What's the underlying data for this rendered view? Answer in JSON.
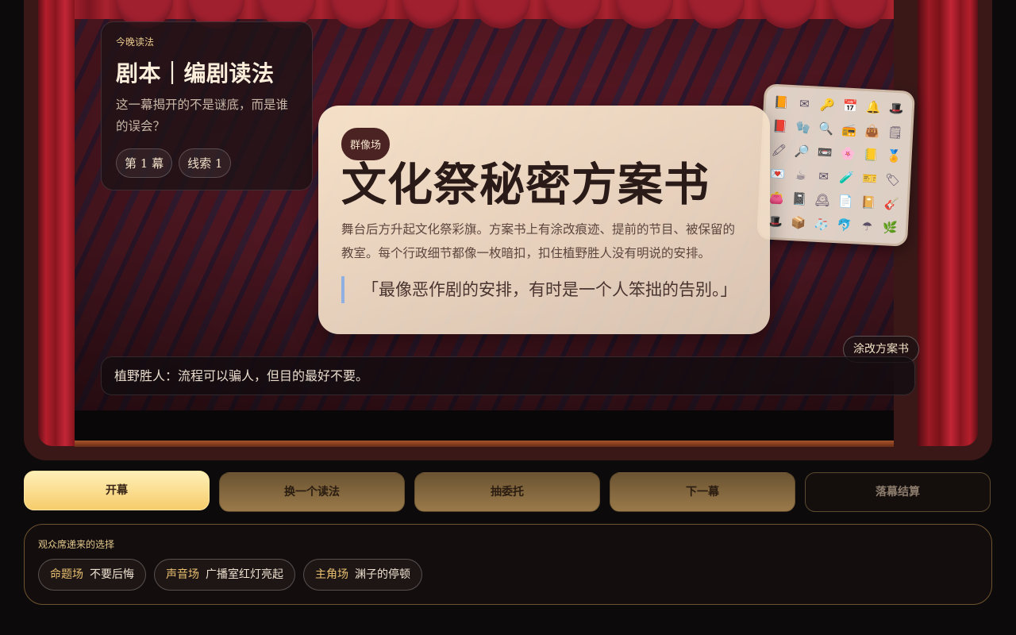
{
  "reading": {
    "kicker": "今晚读法",
    "title": "剧本｜编剧读法",
    "desc": "这一幕揭开的不是谜底，而是谁的误会？",
    "chips": [
      "第 1 幕",
      "线索 1"
    ]
  },
  "scene": {
    "badge": "群像场",
    "title": "文化祭秘密方案书",
    "desc": "舞台后方升起文化祭彩旗。方案书上有涂改痕迹、提前的节目、被保留的教室。每个行政细节都像一枚暗扣，扣住植野胜人没有明说的安排。",
    "quote": "「最像恶作剧的安排，有时是一个人笨拙的告别。」"
  },
  "item_grid_icons": [
    "📙",
    "✉",
    "🔑",
    "📅",
    "🔔",
    "🎩",
    "📕",
    "🧤",
    "🔍",
    "📻",
    "👜",
    "🗒",
    "🖍",
    "🔎",
    "📼",
    "🌸",
    "📒",
    "🏅",
    "💌",
    "☕",
    "✉",
    "🧪",
    "🎫",
    "🏷",
    "👛",
    "📓",
    "🕰",
    "📄",
    "📔",
    "🎸",
    "🎩",
    "📦",
    "🧦",
    "🐬",
    "☂",
    "🌿"
  ],
  "alter_button": "涂改方案书",
  "dialogue": "植野胜人：流程可以骗人，但目的最好不要。",
  "actions": [
    "开幕",
    "换一个读法",
    "抽委托",
    "下一幕",
    "落幕结算"
  ],
  "audience": {
    "kicker": "观众席递来的选择",
    "choices": [
      {
        "tag": "命题场",
        "text": "不要后悔"
      },
      {
        "tag": "声音场",
        "text": "广播室红灯亮起"
      },
      {
        "tag": "主角场",
        "text": "渊子的停顿"
      }
    ]
  },
  "colors": {
    "accent_gold": "#f6cc6b",
    "curtain_red": "#a12030",
    "card_cream": "#fce8ce"
  }
}
